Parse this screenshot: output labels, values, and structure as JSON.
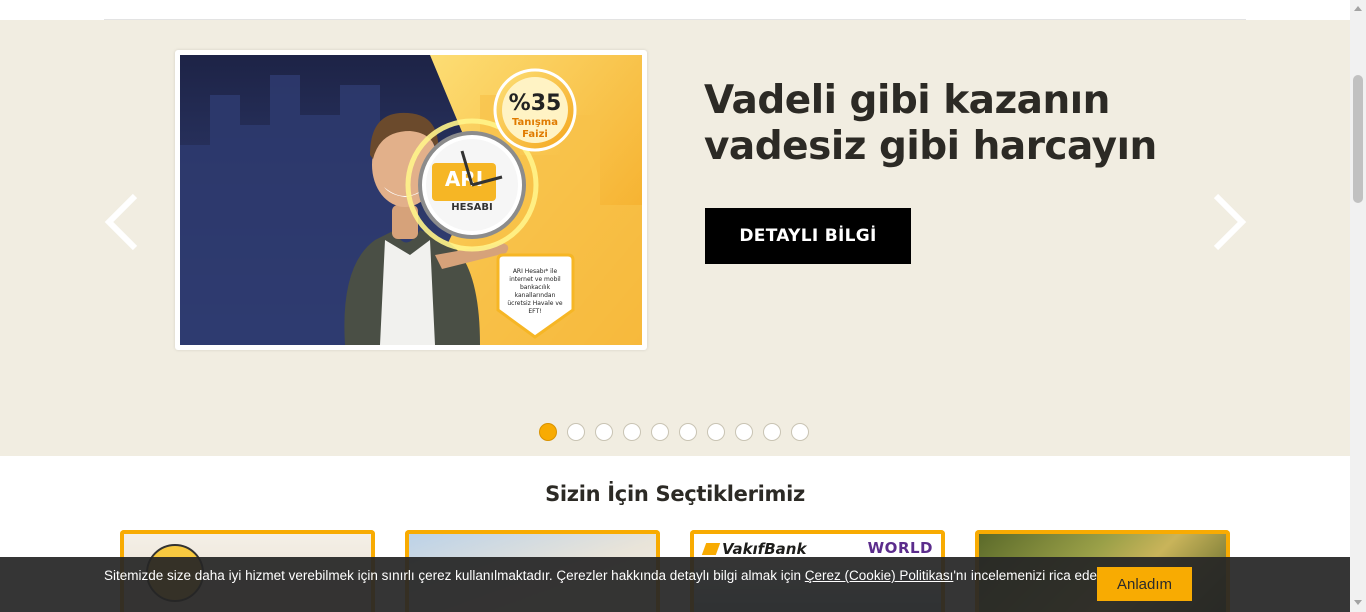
{
  "hero": {
    "headline": "Vadeli gibi kazanın vadesiz gibi harcayın",
    "cta_label": "DETAYLI BİLGİ",
    "slide_count": 10,
    "active_slide": 1,
    "banner": {
      "rate": "%35",
      "rate_caption_1": "Tanışma",
      "rate_caption_2": "Faizi",
      "account_name_1": "ARI",
      "account_name_2": "HESABI",
      "tag_line_1": "ARI Hesabı* ile",
      "tag_line_2": "internet ve mobil",
      "tag_line_3": "bankacılık",
      "tag_line_4": "kanallarından",
      "tag_line_5": "ücretsiz Havale ve",
      "tag_line_6": "EFT!"
    }
  },
  "section": {
    "title": "Sizin İçin Seçtiklerimiz"
  },
  "cards": {
    "card3_logo": "VakıfBank",
    "card3_badge": "WORLD"
  },
  "cookie": {
    "message_before": "Sitemizde size daha iyi hizmet verebilmek için sınırlı çerez kullanılmaktadır. Çerezler hakkında detaylı bilgi almak için ",
    "link_text": "Çerez (Cookie) Politikası",
    "message_after": "'nı incelemenizi rica ederiz.",
    "accept_label": "Anladım"
  },
  "colors": {
    "accent": "#f8ab02",
    "hero_bg": "#f1ede1",
    "text_dark": "#2c2a25"
  }
}
